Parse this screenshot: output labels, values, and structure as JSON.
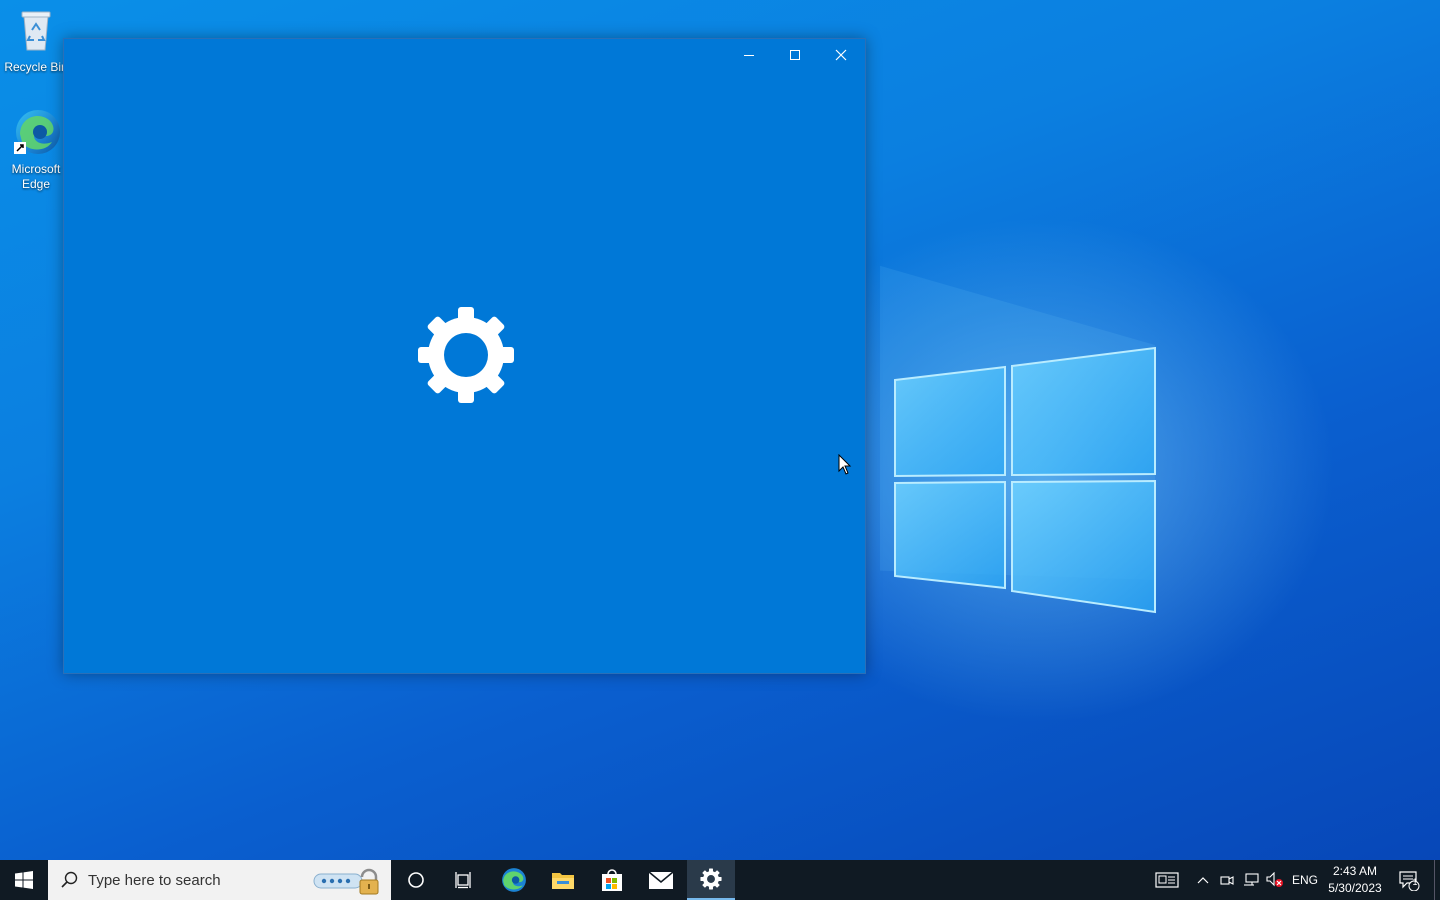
{
  "desktop": {
    "icons": [
      {
        "label": "Recycle Bin",
        "icon": "recycle-bin-icon"
      },
      {
        "label": "Microsoft Edge",
        "icon": "edge-icon"
      }
    ]
  },
  "window": {
    "title_buttons": [
      {
        "icon": "minimize-icon"
      },
      {
        "icon": "maximize-icon"
      },
      {
        "icon": "close-icon"
      }
    ],
    "background": "#0078d7",
    "splash_icon": "gear-icon"
  },
  "taskbar": {
    "start_icon": "windows-start-icon",
    "search": {
      "placeholder": "Type here to search"
    },
    "pinned": [
      {
        "icon": "cortana-icon"
      },
      {
        "icon": "task-view-icon"
      },
      {
        "icon": "edge-icon"
      },
      {
        "icon": "file-explorer-icon"
      },
      {
        "icon": "microsoft-store-icon"
      },
      {
        "icon": "mail-icon"
      },
      {
        "icon": "settings-gear-icon",
        "active": true
      }
    ],
    "tray": {
      "language": "ENG",
      "time": "2:43 AM",
      "date": "5/30/2023",
      "notification_count": "1"
    },
    "accent": "#0078d7"
  }
}
